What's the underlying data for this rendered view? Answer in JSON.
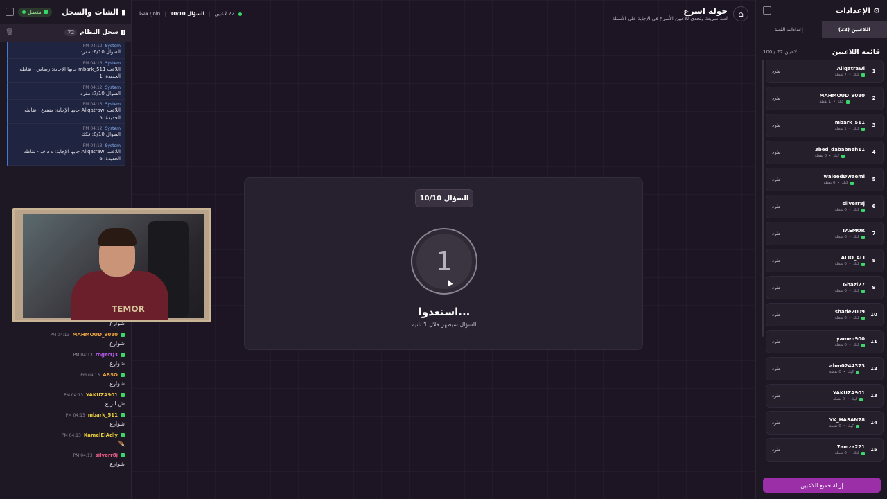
{
  "chat": {
    "title": "الشات والسجل",
    "status": "متصل",
    "system_log_title": "سجل النظام",
    "system_log_count": "72",
    "logs": [
      {
        "sender": "System",
        "time": "PM 04:12",
        "text": "السؤال 6/10: مفرد"
      },
      {
        "sender": "System",
        "time": "PM 04:13",
        "text": "اللاعب mbark_511 جابها الإجابة: رصاص - نقاطه الجديدة: 1"
      },
      {
        "sender": "System",
        "time": "PM 04:12",
        "text": "السؤال 7/10: مفرد"
      },
      {
        "sender": "System",
        "time": "PM 04:13",
        "text": "اللاعب Aliqatrawi جابها الإجابة: ضفدع - نقاطه الجديدة: 5"
      },
      {
        "sender": "System",
        "time": "PM 04:12",
        "text": "السؤال 8/10: فكك"
      },
      {
        "sender": "System",
        "time": "PM 04:13",
        "text": "اللاعب Aliqatrawi جابها الإجابة: ه د ف - نقاطه الجديدة: 6"
      }
    ],
    "messages": [
      {
        "user": "MAHMOUD_9080",
        "color": "#e8a33d",
        "time": "PM 04:13",
        "text": "شوارع"
      },
      {
        "user": "rogerQ3",
        "color": "#b55ee8",
        "time": "PM 04:13",
        "text": "شوارع"
      },
      {
        "user": "ABSO",
        "color": "#e8a33d",
        "time": "PM 04:13",
        "text": "شوارع"
      },
      {
        "user": "YAKUZA901",
        "color": "#e8c53d",
        "time": "PM 04:13",
        "text": "ش ا ر ع"
      },
      {
        "user": "mbark_511",
        "color": "#e8d03d",
        "time": "PM 04:13",
        "text": "شوارع"
      },
      {
        "user": "KamelElAdly",
        "color": "#e8d03d",
        "time": "PM 04:13",
        "text": "🪶"
      },
      {
        "user": "silverr8j",
        "color": "#e85e8a",
        "time": "PM 04:13",
        "text": "شوارع"
      }
    ],
    "partial_message_text": "شوارع"
  },
  "topbar": {
    "game_title": "جولة اسرع",
    "game_subtitle": "لعبة سريعة وتحدي للاعبين الأسرع في الإجابة على الأسئلة",
    "players_count": "22 لاعبين",
    "question_label": "السؤال 10/10",
    "join_note": "join! فقط"
  },
  "center": {
    "question_badge": "السؤال 10/10",
    "countdown": "1",
    "ready_text": "استعدوا...",
    "ready_sub_prefix": "السؤال سيظهر خلال",
    "ready_sub_number": "1",
    "ready_sub_suffix": "ثانية"
  },
  "settings": {
    "title": "الإعدادات",
    "tab_players": "اللاعبين (22)",
    "tab_game_settings": "إعدادات اللعبة",
    "list_title": "قائمة اللاعبين",
    "list_count": "100 / 22 لاعبين",
    "kick_label": "طرد",
    "remove_all": "إزالة جميع اللاعبين",
    "players": [
      {
        "rank": "1",
        "name": "Aliqatrawi",
        "source": "كيك",
        "points": "7 نقطة"
      },
      {
        "rank": "2",
        "name": "MAHMOUD_9080",
        "source": "كيك",
        "points": "1 نقطة"
      },
      {
        "rank": "3",
        "name": "mbark_511",
        "source": "كيك",
        "points": "1 نقطة"
      },
      {
        "rank": "4",
        "name": "3bed_dababneh11",
        "source": "كيك",
        "points": "0 نقطة"
      },
      {
        "rank": "5",
        "name": "waleedDwaemi",
        "source": "كيك",
        "points": "0 نقطة"
      },
      {
        "rank": "6",
        "name": "silverr8j",
        "source": "كيك",
        "points": "0 نقطة"
      },
      {
        "rank": "7",
        "name": "TAEMOR",
        "source": "كيك",
        "points": "0 نقطة"
      },
      {
        "rank": "8",
        "name": "ALIO_ALI",
        "source": "كيك",
        "points": "0 نقطة"
      },
      {
        "rank": "9",
        "name": "Ghazi27",
        "source": "كيك",
        "points": "0 نقطة"
      },
      {
        "rank": "10",
        "name": "shade2009",
        "source": "كيك",
        "points": "0 نقطة"
      },
      {
        "rank": "11",
        "name": "yamen900",
        "source": "كيك",
        "points": "0 نقطة"
      },
      {
        "rank": "12",
        "name": "ahm0244373",
        "source": "كيك",
        "points": "0 نقطة"
      },
      {
        "rank": "13",
        "name": "YAKUZA901",
        "source": "كيك",
        "points": "0 نقطة"
      },
      {
        "rank": "14",
        "name": "YK_HASAN78",
        "source": "كيك",
        "points": "0 نقطة"
      },
      {
        "rank": "15",
        "name": "7amza221",
        "source": "كيك",
        "points": "0 نقطة"
      }
    ]
  },
  "webcam_logo": "TEMOR",
  "icons": {
    "home": "home-icon",
    "gear": "gear-icon",
    "chat": "chat-icon",
    "collapse": "collapse-panel-icon",
    "trash": "trash-icon",
    "check": "kick-check-icon"
  },
  "colors": {
    "accent": "#9b2fa8",
    "online": "#3bd66a",
    "log_border": "#3d7bd9"
  }
}
